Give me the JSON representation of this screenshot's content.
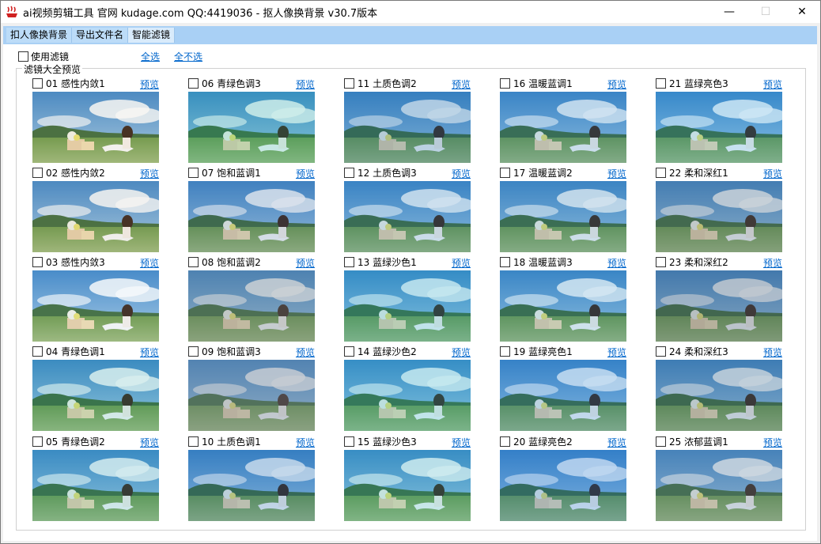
{
  "window": {
    "title": "ai视频剪辑工具 官网 kudage.com QQ:4419036 -  抠人像换背景  v30.7版本",
    "minimize": "—",
    "maximize": "☐",
    "close": "✕"
  },
  "menu": {
    "items": [
      "扣人像换背景",
      "导出文件名",
      "智能滤镜"
    ]
  },
  "toolbar": {
    "use_filter_label": "使用滤镜",
    "select_all": "全选",
    "select_none": "全不选"
  },
  "group": {
    "title": "滤镜大全预览"
  },
  "preview_label": "预览",
  "filters": [
    {
      "label": "01 感性内敛1",
      "tint": "#c8b48a",
      "opacity": 0.1
    },
    {
      "label": "02 感性内敛2",
      "tint": "#b8a88a",
      "opacity": 0.12
    },
    {
      "label": "03 感性内敛3",
      "tint": "#a8c0d8",
      "opacity": 0.1
    },
    {
      "label": "04 青绿色调1",
      "tint": "#2aa8a0",
      "opacity": 0.18
    },
    {
      "label": "05 青绿色调2",
      "tint": "#2aa0b0",
      "opacity": 0.2
    },
    {
      "label": "06 青绿色调3",
      "tint": "#22b0a0",
      "opacity": 0.22
    },
    {
      "label": "07 饱和蓝调1",
      "tint": "#4870a0",
      "opacity": 0.2
    },
    {
      "label": "08 饱和蓝调2",
      "tint": "#6a7a88",
      "opacity": 0.35
    },
    {
      "label": "09 饱和蓝调3",
      "tint": "#708090",
      "opacity": 0.4
    },
    {
      "label": "10 土质色调1",
      "tint": "#1a68b0",
      "opacity": 0.25
    },
    {
      "label": "11 土质色调2",
      "tint": "#1e6aa8",
      "opacity": 0.28
    },
    {
      "label": "12 土质色调3",
      "tint": "#2a7ab8",
      "opacity": 0.22
    },
    {
      "label": "13 蓝绿沙色1",
      "tint": "#18a0c0",
      "opacity": 0.25
    },
    {
      "label": "14 蓝绿沙色2",
      "tint": "#1aa8c0",
      "opacity": 0.25
    },
    {
      "label": "15 蓝绿沙色3",
      "tint": "#20a8b8",
      "opacity": 0.22
    },
    {
      "label": "16 温暖蓝调1",
      "tint": "#2880c0",
      "opacity": 0.22
    },
    {
      "label": "17 温暖蓝调2",
      "tint": "#3080b0",
      "opacity": 0.22
    },
    {
      "label": "18 温暖蓝调3",
      "tint": "#2888c0",
      "opacity": 0.2
    },
    {
      "label": "19 蓝绿亮色1",
      "tint": "#1a78c8",
      "opacity": 0.25
    },
    {
      "label": "20 蓝绿亮色2",
      "tint": "#1870c8",
      "opacity": 0.28
    },
    {
      "label": "21 蓝绿亮色3",
      "tint": "#1a90d0",
      "opacity": 0.22
    },
    {
      "label": "22 柔和深红1",
      "tint": "#506a80",
      "opacity": 0.3
    },
    {
      "label": "23 柔和深红2",
      "tint": "#4a6078",
      "opacity": 0.35
    },
    {
      "label": "24 柔和深红3",
      "tint": "#3a6888",
      "opacity": 0.3
    },
    {
      "label": "25 浓郁蓝调1",
      "tint": "#5a7a98",
      "opacity": 0.3
    }
  ],
  "colors": {
    "menubar": "#a9d0f5",
    "link": "#0066cc",
    "sky": "#7fb2e0",
    "grass": "#7aa050"
  }
}
